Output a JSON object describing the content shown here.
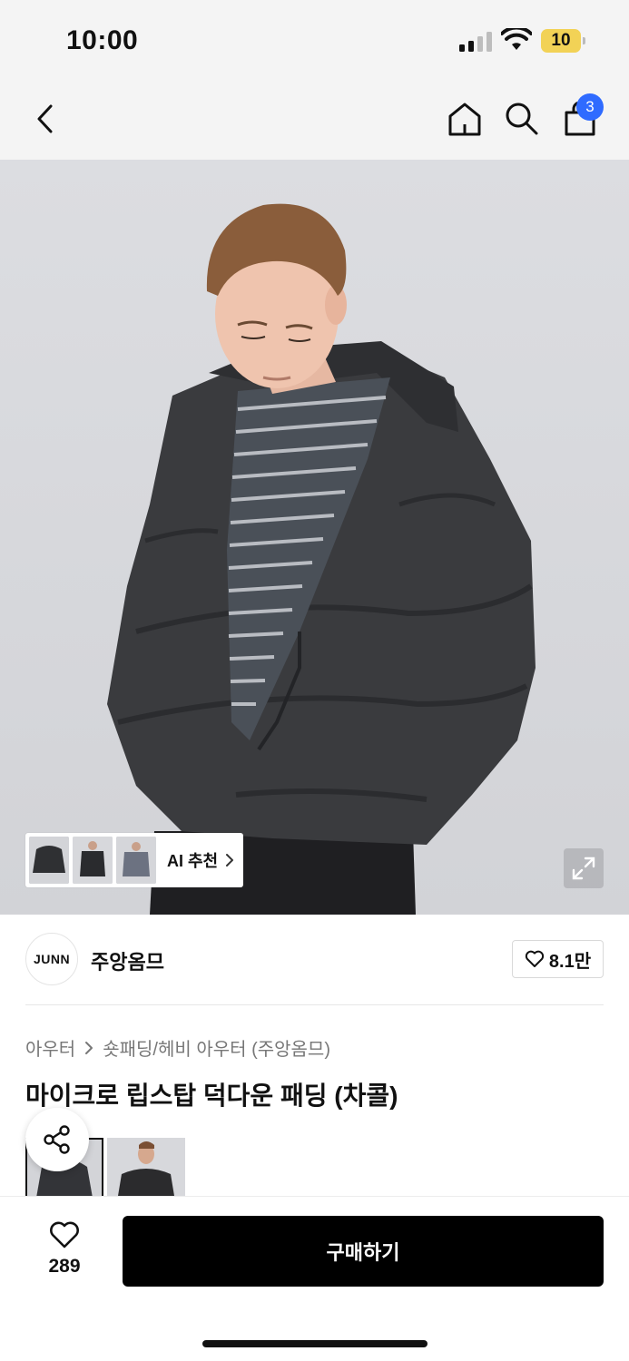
{
  "status_bar": {
    "time": "10:00",
    "battery": "10",
    "icons": [
      "signal-icon",
      "wifi-icon",
      "battery-icon"
    ]
  },
  "nav": {
    "icons": [
      "back-icon",
      "home-icon",
      "search-icon",
      "shopping-bag-icon"
    ],
    "cart_count": "3"
  },
  "hero": {
    "ai_recommend_label": "AI 추천",
    "icons": [
      "chevron-right-icon",
      "expand-icon"
    ]
  },
  "brand": {
    "logo_text": "JUNN",
    "name": "주앙옴므",
    "likes": "8.1만"
  },
  "breadcrumb": {
    "category": "아우터",
    "subcategory": "숏패딩/헤비 아우터 (주앙옴므)"
  },
  "product": {
    "title": "마이크로 립스탑 덕다운 패딩 (차콜)"
  },
  "bottom_bar": {
    "wish_count": "289",
    "buy_label": "구매하기"
  },
  "colors": {
    "accent_blue": "#2f6bff",
    "battery_yellow": "#f2d256",
    "buy_button": "#000000"
  }
}
